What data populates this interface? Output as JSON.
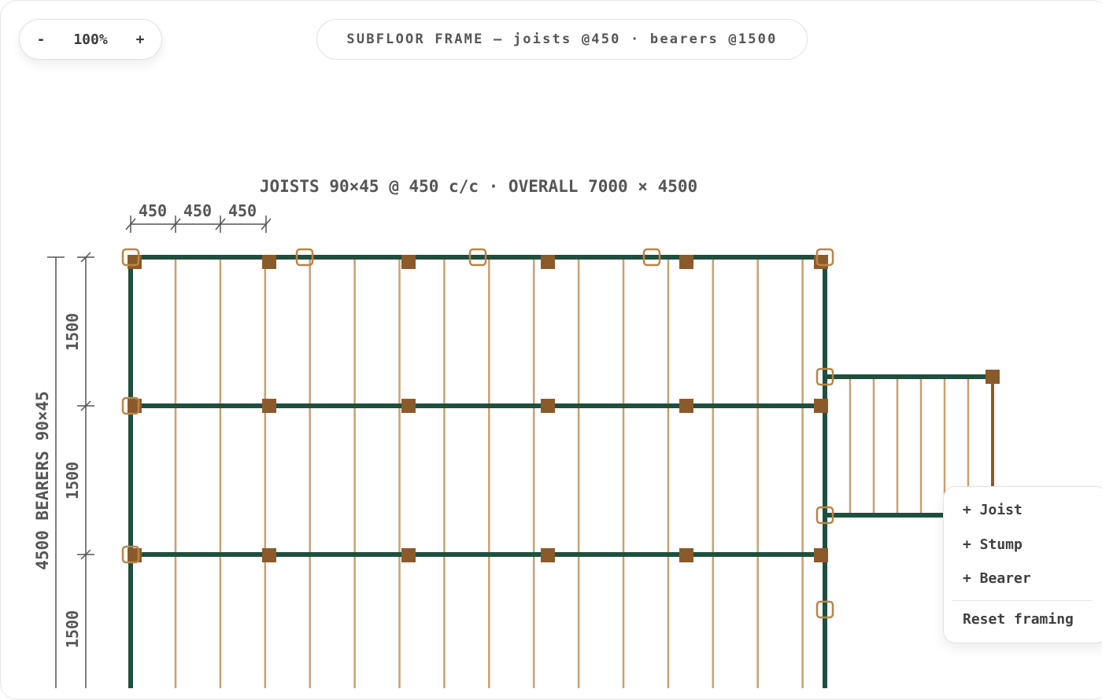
{
  "zoom": {
    "minus_label": "-",
    "plus_label": "+",
    "value": "100%"
  },
  "header": {
    "title": "SUBFLOOR FRAME — joists @450 · bearers @1500"
  },
  "drawing": {
    "top_label": "JOISTS 90×45 @ 450 c/c · OVERALL 7000 × 4500",
    "joist_spacing_labels": [
      "450",
      "450",
      "450"
    ],
    "bearer_spacing_labels": [
      "1500",
      "1500",
      "1500"
    ],
    "overall_side_label": "4500 BEARERS 90×45"
  },
  "context_menu": {
    "items": [
      "+ Joist",
      "+ Stump",
      "+ Bearer"
    ],
    "reset_label": "Reset framing"
  },
  "colors": {
    "bearer": "#1f4f3e",
    "joist": "#c9a072",
    "stump": "#8b5a2b",
    "dimension": "#555555"
  }
}
